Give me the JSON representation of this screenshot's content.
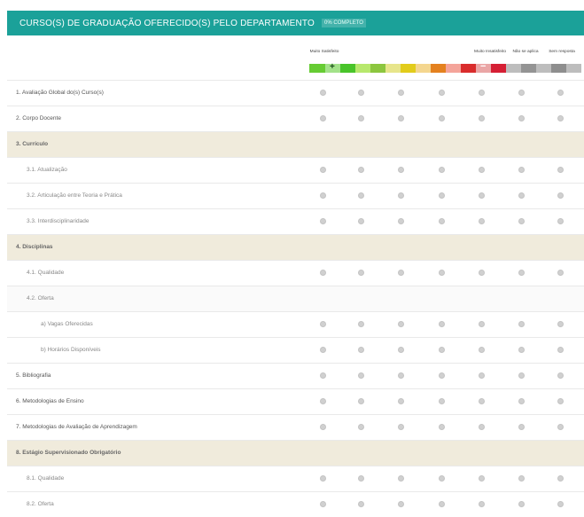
{
  "header": {
    "title": "Curso(s) de Graduação Oferecido(s) pelo Departamento",
    "badge": "0% COMPLETO",
    "color": "#1ba199"
  },
  "scale": {
    "muito_satisfeito": "Muito Satisfeito",
    "muito_insatisfeito": "Muito Insatisfeito",
    "nao_se_aplica": "Não se aplica",
    "sem_resposta": "Sem resposta",
    "plus": "+",
    "minus": "−",
    "colors": [
      "#66cc33",
      "#a3e28a",
      "#49c42a",
      "#b7e86d",
      "#8cc63f",
      "#e7e58b",
      "#e2cc1b",
      "#f4d68f",
      "#e4811f",
      "#f4a49a",
      "#d92c2c",
      "#eaa6a6",
      "#d51f34",
      "#bdbdbd",
      "#949494",
      "#bdbdbd",
      "#8e8e8e",
      "#bdbdbd"
    ]
  },
  "rows": [
    {
      "label": "1. Avaliação Global do(s) Curso(s)",
      "type": "top",
      "radios": true
    },
    {
      "label": "2. Corpo Docente",
      "type": "top",
      "radios": true
    },
    {
      "label": "3. Currículo",
      "type": "section",
      "radios": false
    },
    {
      "label": "3.1. Atualização",
      "type": "child",
      "radios": true
    },
    {
      "label": "3.2. Articulação entre Teoria e Prática",
      "type": "child",
      "radios": true
    },
    {
      "label": "3.3. Interdisciplinaridade",
      "type": "child",
      "radios": true
    },
    {
      "label": "4. Disciplinas",
      "type": "section",
      "radios": false
    },
    {
      "label": "4.1. Qualidade",
      "type": "child",
      "radios": true
    },
    {
      "label": "4.2. Oferta",
      "type": "child alt",
      "radios": false
    },
    {
      "label": "a) Vagas Oferecidas",
      "type": "grand",
      "radios": true
    },
    {
      "label": "b) Horários Disponíveis",
      "type": "grand",
      "radios": true
    },
    {
      "label": "5. Bibliografia",
      "type": "top",
      "radios": true
    },
    {
      "label": "6. Metodologias de Ensino",
      "type": "top",
      "radios": true
    },
    {
      "label": "7. Metodologias de Avaliação de Aprendizagem",
      "type": "top",
      "radios": true
    },
    {
      "label": "8. Estágio Supervisionado Obrigatório",
      "type": "section",
      "radios": false
    },
    {
      "label": "8.1. Qualidade",
      "type": "child",
      "radios": true
    },
    {
      "label": "8.2. Oferta",
      "type": "child",
      "radios": true
    }
  ]
}
